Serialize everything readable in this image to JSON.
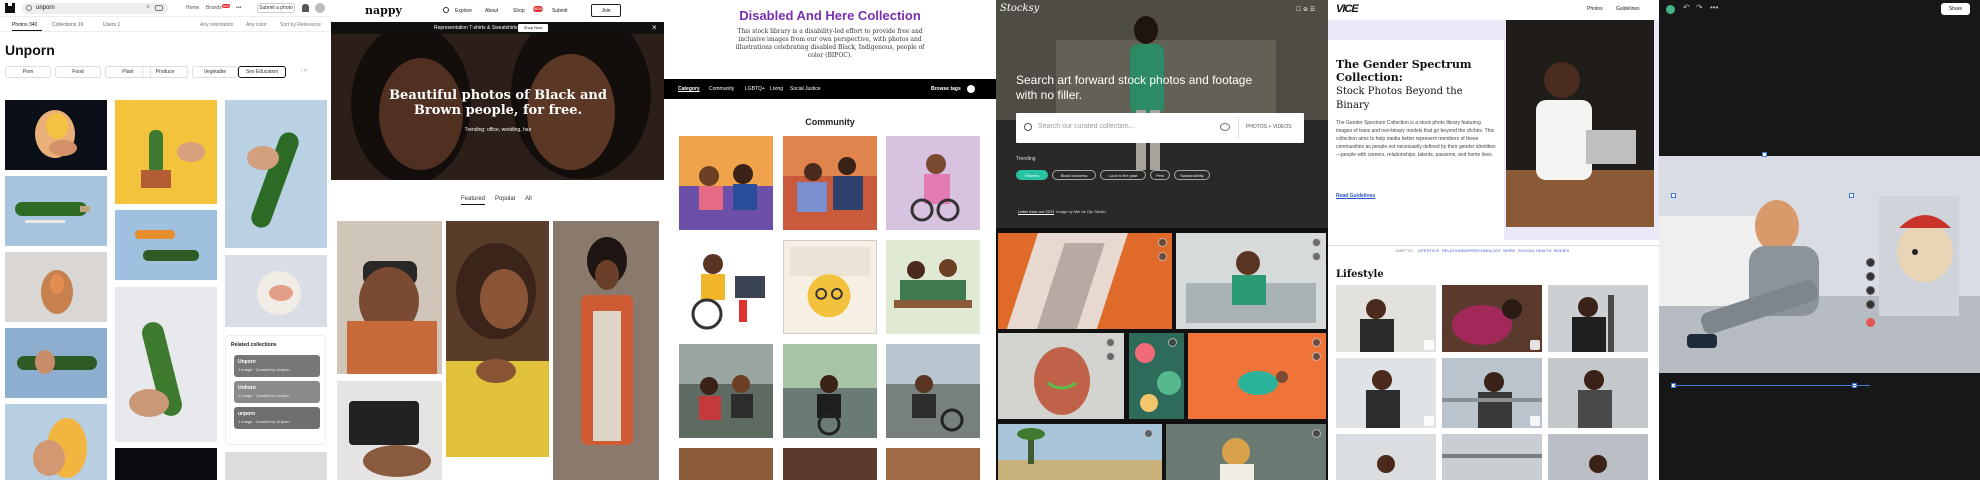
{
  "unsplash": {
    "search_value": "unporn",
    "nav": [
      "Home",
      "Brands",
      "•••"
    ],
    "brands_badge": "New",
    "submit_label": "Submit a photo",
    "tabs": [
      "Photos 340",
      "Collections 16",
      "Users 1"
    ],
    "filters": [
      "Any orientation",
      "Any color",
      "Sort by Relevance"
    ],
    "title": "Unporn",
    "chips": [
      "Porn",
      "Food",
      "Plant",
      "Produce",
      "Vegetable",
      "Sex Education"
    ],
    "related": {
      "title": "Related collections",
      "items": [
        {
          "name": "Unporn",
          "meta": "1 image · Curated by Unporn"
        },
        {
          "name": "Unhorn",
          "meta": "1 image · Curated by Unporn"
        },
        {
          "name": "unporn",
          "meta": "1 image · Curated by Unporn"
        }
      ]
    }
  },
  "nappy": {
    "brand": "nappy",
    "nav": [
      "Explore",
      "About",
      "Shop",
      "Submit"
    ],
    "shop_badge": "NEW",
    "join": "Join",
    "promo_text": "Representation T-shirts & Sweatshirts",
    "promo_button": "Shop Now",
    "promo_close": "×",
    "hero_title": "Beautiful photos of Black and Brown people, for free.",
    "hero_trending": "Trending: office, wedding, hair",
    "tabs": [
      "Featured",
      "Popular",
      "All"
    ]
  },
  "disabled": {
    "title": "Disabled And Here Collection",
    "description": "This stock library is a disability-led effort to provide free and inclusive images from our own perspective, with photos and illustrations celebrating disabled Black, Indigenous, people of color (BIPOC).",
    "nav": [
      "Category",
      "Community",
      "LGBTQ+",
      "Living",
      "Social Justice"
    ],
    "browse": "Browse tags",
    "section": "Community"
  },
  "stocksy": {
    "brand": "Stocksy",
    "top_icons": "☐ ⊕ ☰",
    "headline": "Search art forward stock photos and footage with no filler.",
    "search_placeholder": "Search our curated collection...",
    "search_mode": "PHOTOS + VIDEOS",
    "trending": "Trending",
    "chips": [
      "Women",
      "Black business",
      "Look to the past",
      "Pets",
      "Sustainability"
    ],
    "credit_link": "Letter from our CEO",
    "credit_text": "Image by Mel de Ojo Studio"
  },
  "vice": {
    "brand": "VICE",
    "nav": [
      "Photos",
      "Guidelines"
    ],
    "title": "The Gender Spectrum Collection:",
    "subtitle": "Stock Photos Beyond the Binary",
    "body": "The Gender Spectrum Collection is a stock photo library featuring images of trans and non-binary models that go beyond the clichés. This collection aims to help media better represent members of these communities as people not necessarily defined by their gender identities—people with careers, relationships, talents, passions, and home lives.",
    "link": "Read Guidelines",
    "jump_label": "JUMP TO:",
    "jump": [
      "LIFESTYLE",
      "RELATIONSHIPS",
      "TECHNOLOGY",
      "WORK",
      "SCHOOL",
      "HEALTH",
      "BODIES"
    ],
    "section": "Lifestyle"
  },
  "editor": {
    "undo": "↶",
    "redo": "↷",
    "more": "•••",
    "share": "Share"
  },
  "colors": {
    "disabled_purple": "#7a2fb0",
    "stocksy_teal": "#29c3a4",
    "vice_lavender": "#eae8f6",
    "editor_blue": "#3f7bd8"
  }
}
